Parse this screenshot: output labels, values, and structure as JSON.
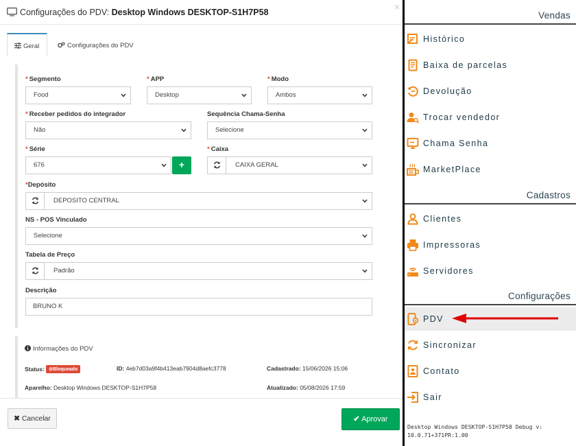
{
  "modal": {
    "title_prefix": "Configurações do PDV: ",
    "title_bold": "Desktop Windows DESKTOP-S1H7P58",
    "close": "×",
    "tabs": [
      {
        "label": "Geral"
      },
      {
        "label": "Configurações do PDV"
      }
    ],
    "form": {
      "segmento": {
        "label": "Segmento",
        "value": "Food"
      },
      "app": {
        "label": "APP",
        "value": "Desktop"
      },
      "modo": {
        "label": "Modo",
        "value": "Ambos"
      },
      "receber": {
        "label": "Receber pedidos do integrador",
        "value": "Não"
      },
      "sequencia": {
        "label": "Sequência Chama-Senha",
        "value": "Selecione"
      },
      "serie": {
        "label": "Série",
        "value": "676",
        "add": "+"
      },
      "caixa": {
        "label": "Caixa",
        "value": "CAIXA GERAL"
      },
      "deposito": {
        "label": "Depósito",
        "value": "DEPOSITO CENTRAL"
      },
      "ns_pos": {
        "label": "NS - POS Vinculado",
        "value": "Selecione"
      },
      "tabela": {
        "label": "Tabela de Preço",
        "value": "Padrão"
      },
      "descricao": {
        "label": "Descrição",
        "value": "BRUNO K"
      }
    },
    "info": {
      "title": "Informações do PDV",
      "status_label": "Status:",
      "status_value": "Bloqueado",
      "id_label": "ID:",
      "id_value": "4eb7d03a9f4b413eab7904d8aefc3778",
      "cadastrado_label": "Cadastrado:",
      "cadastrado_value": "15/06/2026 15:06",
      "aparelho_label": "Aparelho:",
      "aparelho_value": "Desktop Windows DESKTOP-S1H7P58",
      "atualizado_label": "Atualizado:",
      "atualizado_value": "05/08/2026 17:59"
    },
    "footer": {
      "cancel_label": "Cancelar",
      "ok_label": "Aprovar"
    }
  },
  "sidebar": {
    "sections": [
      {
        "title": "Vendas",
        "items": [
          "Histórico",
          "Baixa de parcelas",
          "Devolução",
          "Trocar vendedor",
          "Chama Senha",
          "MarketPlace"
        ]
      },
      {
        "title": "Cadastros",
        "items": [
          "Clientes",
          "Impressoras",
          "Servidores"
        ]
      },
      {
        "title": "Configurações",
        "items": [
          "PDV",
          "Sincronizar",
          "Contato",
          "Sair"
        ]
      }
    ],
    "footer": "Desktop Windows DESKTOP-S1H7P58 Debug v: 10.0.71+371PR:1.00"
  },
  "colors": {
    "accent_orange": "#f18a1a",
    "success_green": "#00a65a",
    "danger_red": "#dd4b39",
    "progress_orange": "#f39c12",
    "annotation_arrow": "#e00000"
  }
}
